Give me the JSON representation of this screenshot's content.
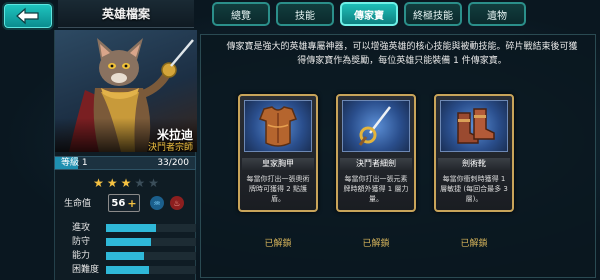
{
  "header": {
    "title": "英雄檔案"
  },
  "tabs": [
    {
      "label": "總覽",
      "active": false
    },
    {
      "label": "技能",
      "active": false
    },
    {
      "label": "傳家寶",
      "active": true
    },
    {
      "label": "終極技能",
      "active": false
    },
    {
      "label": "遺物",
      "active": false
    }
  ],
  "hero": {
    "name": "米拉迪",
    "title": "決鬥者宗師",
    "level_label": "等級 1",
    "level_value": "33/200",
    "level_progress": 0.165,
    "stars_filled": 3,
    "stars_total": 5,
    "hp_label": "生命值",
    "hp_value": "56",
    "hp_plus": "+"
  },
  "stats": [
    {
      "label": "進攻",
      "level": 0.55
    },
    {
      "label": "防守",
      "level": 0.5
    },
    {
      "label": "能力",
      "level": 0.42
    },
    {
      "label": "困難度",
      "level": 0.48
    }
  ],
  "description": "傳家寶是強大的英雄專屬神器，可以增強英雄的核心技能與被動技能。碎片戰結束後可獲得傳家寶作為獎勵，每位英雄只能裝備 1 件傳家寶。",
  "heirlooms": [
    {
      "name": "皇家胸甲",
      "desc": "每當你打出一張奧術牌時可獲得 2 點護盾。",
      "status": "已解鎖",
      "icon": "breastplate-icon"
    },
    {
      "name": "決鬥者細劍",
      "desc": "每當你打出一張元素牌時額外獲得 1 層力量。",
      "status": "已解鎖",
      "icon": "rapier-icon"
    },
    {
      "name": "劍術靴",
      "desc": "每當你衝刺時獲得 1 層敏捷 (每回合最多 3 層)。",
      "status": "已解鎖",
      "icon": "boots-icon"
    }
  ],
  "colors": {
    "accent": "#1ebfb8",
    "gold": "#d4b25a",
    "stat_bar": "#2fb8d8"
  }
}
